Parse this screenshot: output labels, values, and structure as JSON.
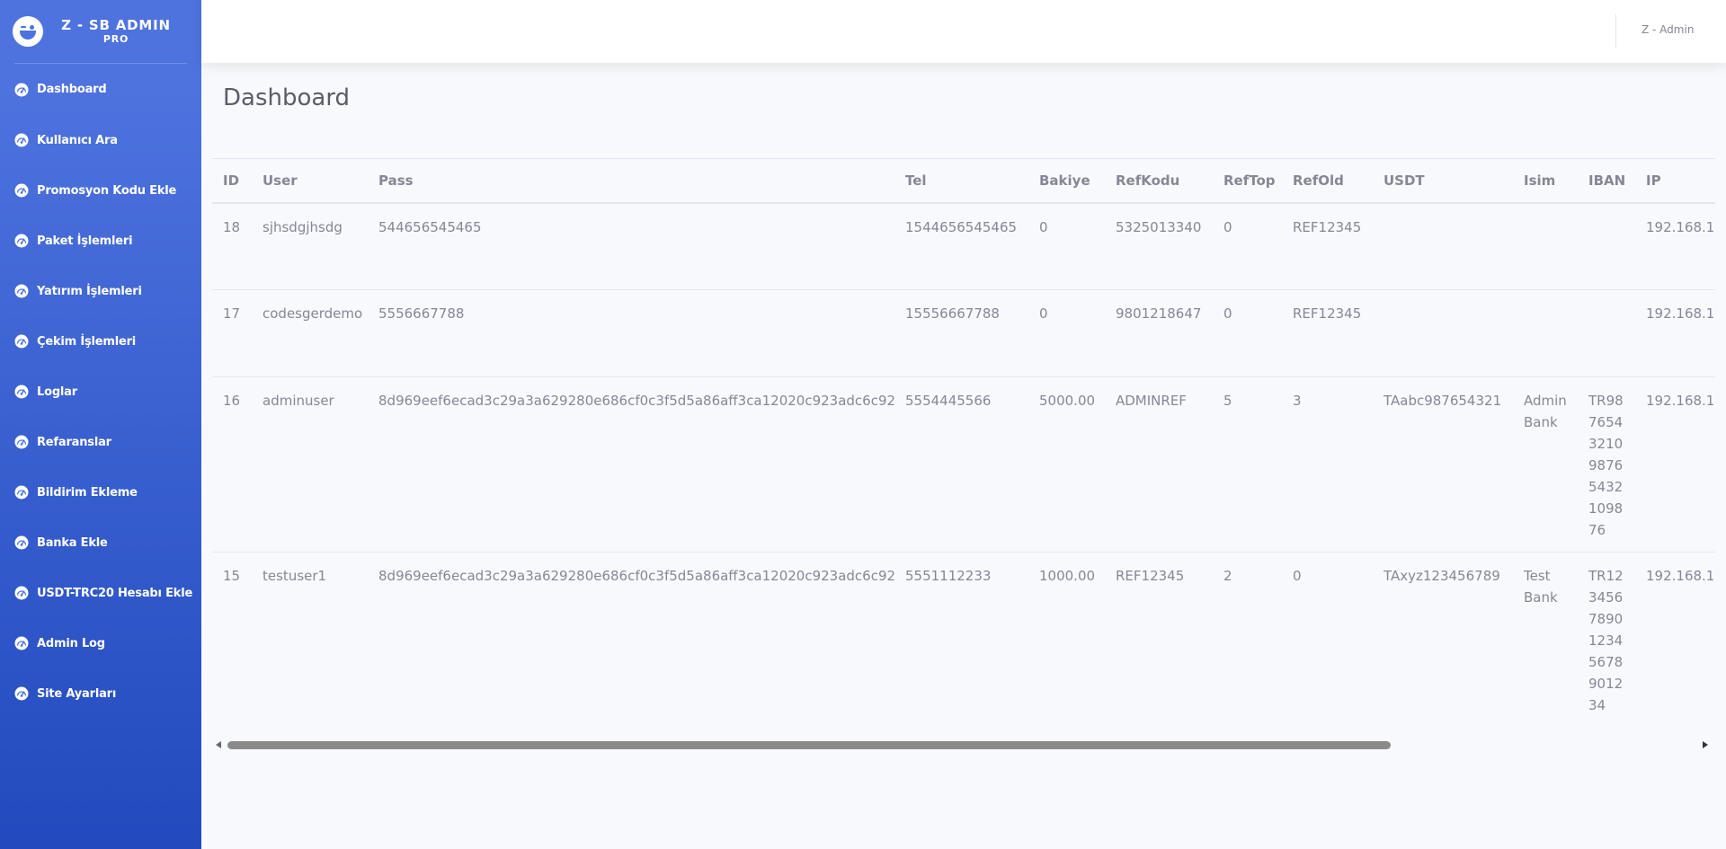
{
  "brand": {
    "title": "Z - SB ADMIN",
    "subtitle": "PRO"
  },
  "sidebar": {
    "items": [
      {
        "label": "Dashboard",
        "icon": "tachometer-icon"
      },
      {
        "label": "Kullanıcı Ara",
        "icon": "tachometer-icon"
      },
      {
        "label": "Promosyon Kodu Ekle",
        "icon": "tachometer-icon"
      },
      {
        "label": "Paket İşlemleri",
        "icon": "tachometer-icon"
      },
      {
        "label": "Yatırım İşlemleri",
        "icon": "tachometer-icon"
      },
      {
        "label": "Çekim İşlemleri",
        "icon": "tachometer-icon"
      },
      {
        "label": "Loglar",
        "icon": "tachometer-icon"
      },
      {
        "label": "Refaranslar",
        "icon": "tachometer-icon"
      },
      {
        "label": "Bildirim Ekleme",
        "icon": "tachometer-icon"
      },
      {
        "label": "Banka Ekle",
        "icon": "tachometer-icon"
      },
      {
        "label": "USDT-TRC20 Hesabı Ekle",
        "icon": "tachometer-icon"
      },
      {
        "label": "Admin Log",
        "icon": "tachometer-icon"
      },
      {
        "label": "Site Ayarları",
        "icon": "tachometer-icon"
      }
    ]
  },
  "topbar": {
    "user": "Z - Admin"
  },
  "page": {
    "title": "Dashboard"
  },
  "table": {
    "headers": [
      "ID",
      "User",
      "Pass",
      "Tel",
      "Bakiye",
      "RefKodu",
      "RefTop",
      "RefOld",
      "USDT",
      "Isim",
      "IBAN",
      "IP"
    ],
    "rows": [
      [
        "18",
        "sjhsdgjhsdg",
        "544656545465",
        "1544656545465",
        "0",
        "5325013340",
        "0",
        "REF12345",
        "",
        "",
        "",
        "192.168.1."
      ],
      [
        "17",
        "codesgerdemo",
        "5556667788",
        "15556667788",
        "0",
        "9801218647",
        "0",
        "REF12345",
        "",
        "",
        "",
        "192.168.1."
      ],
      [
        "16",
        "adminuser",
        "8d969eef6ecad3c29a3a629280e686cf0c3f5d5a86aff3ca12020c923adc6c92",
        "5554445566",
        "5000.00",
        "ADMINREF",
        "5",
        "3",
        "TAabc987654321",
        "Admin Bank",
        "TR987654321098765432109876",
        "192.168.1."
      ],
      [
        "15",
        "testuser1",
        "8d969eef6ecad3c29a3a629280e686cf0c3f5d5a86aff3ca12020c923adc6c92",
        "5551112233",
        "1000.00",
        "REF12345",
        "2",
        "0",
        "TAxyz123456789",
        "Test Bank",
        "TR123456789012345678901234",
        "192.168.1."
      ]
    ]
  },
  "colors": {
    "primary": "#4e73df",
    "primary_dark": "#224abe",
    "text_muted": "#858796",
    "heading": "#5a5c69",
    "bg": "#f8f9fc"
  }
}
